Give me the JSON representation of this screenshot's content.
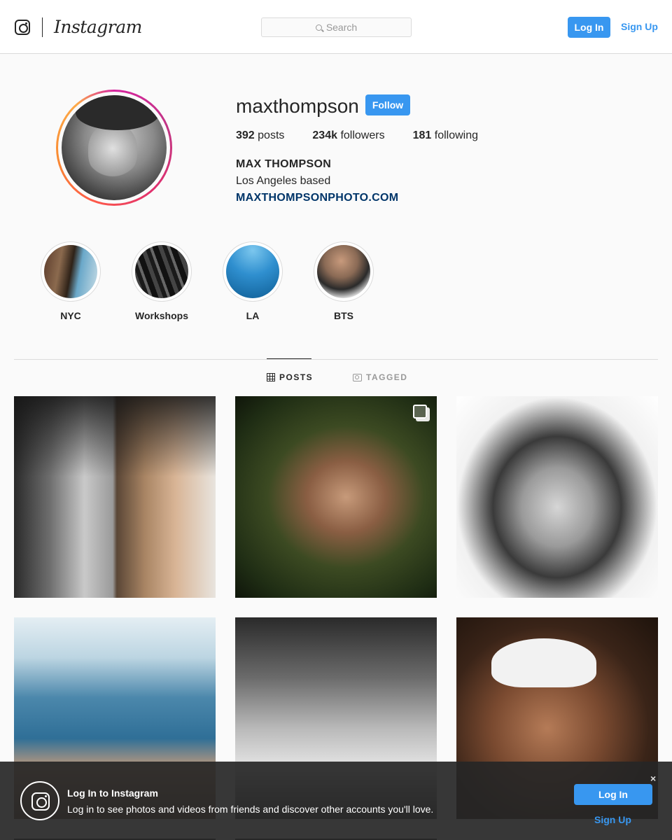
{
  "header": {
    "wordmark": "Instagram",
    "search_placeholder": "Search",
    "login_label": "Log In",
    "signup_label": "Sign Up"
  },
  "profile": {
    "username": "maxthompson",
    "follow_label": "Follow",
    "stats": [
      {
        "value": "392",
        "label": "posts"
      },
      {
        "value": "234k",
        "label": "followers"
      },
      {
        "value": "181",
        "label": "following"
      }
    ],
    "full_name": "MAX THOMPSON",
    "bio": "Los Angeles based",
    "website": "MAXTHOMPSONPHOTO.COM"
  },
  "highlights": [
    {
      "label": "NYC"
    },
    {
      "label": "Workshops"
    },
    {
      "label": "LA"
    },
    {
      "label": "BTS"
    }
  ],
  "tabs": [
    {
      "label": "POSTS",
      "active": true,
      "icon": "grid-icon"
    },
    {
      "label": "TAGGED",
      "active": false,
      "icon": "tagged-icon"
    }
  ],
  "posts": [
    {
      "icon": null
    },
    {
      "icon": "multiple-photos-icon"
    },
    {
      "icon": null
    },
    {
      "icon": null
    },
    {
      "icon": null
    },
    {
      "icon": null
    }
  ],
  "login_banner": {
    "title": "Log In to Instagram",
    "text": "Log in to see photos and videos from friends and discover other accounts you'll love.",
    "login_label": "Log In",
    "signup_label": "Sign Up",
    "close_label": "×"
  },
  "colors": {
    "accent": "#3897f0",
    "link": "#003569",
    "background": "#fafafa"
  }
}
